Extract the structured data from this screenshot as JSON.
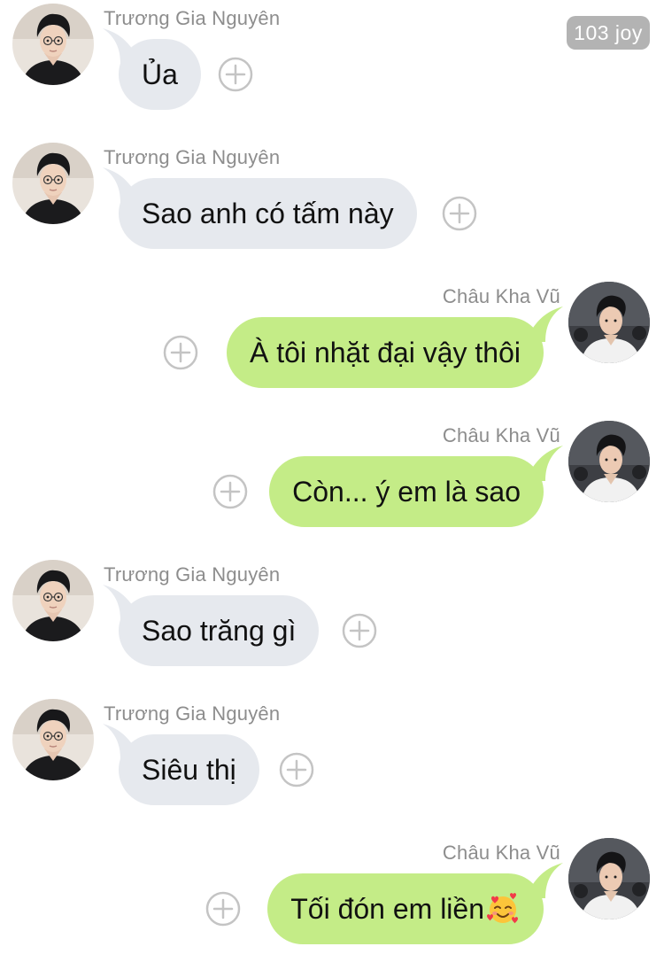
{
  "badge": {
    "text": "103 joy"
  },
  "senders": {
    "incoming": "Trương Gia Nguyên",
    "outgoing": "Châu Kha Vũ"
  },
  "messages": [
    {
      "direction": "in",
      "sender": "Trương Gia Nguyên",
      "text": "Ủa"
    },
    {
      "direction": "in",
      "sender": "Trương Gia Nguyên",
      "text": "Sao anh có tấm này"
    },
    {
      "direction": "out",
      "sender": "Châu Kha Vũ",
      "text": "À tôi nhặt đại vậy thôi"
    },
    {
      "direction": "out",
      "sender": "Châu Kha Vũ",
      "text": "Còn... ý em là sao"
    },
    {
      "direction": "in",
      "sender": "Trương Gia Nguyên",
      "text": "Sao trăng gì"
    },
    {
      "direction": "in",
      "sender": "Trương Gia Nguyên",
      "text": "Siêu thị"
    },
    {
      "direction": "out",
      "sender": "Châu Kha Vũ",
      "text": "Tối đón em liền",
      "emoji": "smiling-face-with-hearts-icon"
    }
  ],
  "colors": {
    "incoming_bubble": "#e6e9ee",
    "outgoing_bubble": "#c4ec87",
    "sender_text": "#8d8d8d",
    "badge_bg": "#b3b3b3",
    "add_icon": "#c4c4c4"
  },
  "icons": {
    "add": "plus-circle-icon",
    "avatar_incoming": "avatar-photo",
    "avatar_outgoing": "avatar-photo"
  }
}
